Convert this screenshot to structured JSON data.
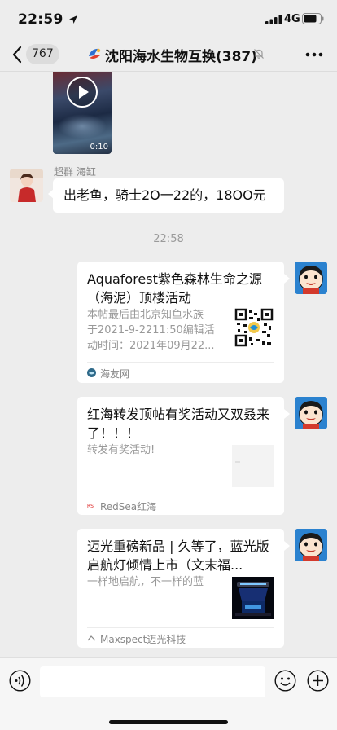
{
  "status_bar": {
    "time": "22:59",
    "network": "4G"
  },
  "nav": {
    "unread_count": "767",
    "title": "沈阳海水生物互换(387)"
  },
  "messages": {
    "video": {
      "duration": "0:10"
    },
    "text_message": {
      "sender": "超群 海缸",
      "text": "出老鱼，骑士2O一22的，18OO元"
    },
    "timestamp": "22:58",
    "cards": [
      {
        "title": "Aquaforest紫色森林生命之源（海泥）顶楼活动",
        "desc_lines": [
          "本帖最后由北京知鱼水族",
          "于2021-9-2211:50编辑活",
          "动时间：2021年09月22..."
        ],
        "source": "海友网",
        "thumb": "qr-code"
      },
      {
        "title": "红海转发顶帖有奖活动又双叒来了！！！",
        "desc_lines": [
          "转发有奖活动!"
        ],
        "source": "RedSea红海",
        "thumb": "blank-image"
      },
      {
        "title": "迈光重磅新品 | 久等了，蓝光版启航灯倾情上市（文末福...",
        "desc_lines": [
          "一样地启航，不一样的蓝"
        ],
        "source": "Maxspect迈光科技",
        "thumb": "aquarium-light"
      }
    ]
  },
  "input": {
    "value": "",
    "placeholder": ""
  },
  "icons": {
    "back": "chevron-left-icon",
    "more": "ellipsis-icon",
    "voice": "voice-icon",
    "emoji": "emoji-icon",
    "plus": "plus-icon",
    "play": "play-icon"
  }
}
